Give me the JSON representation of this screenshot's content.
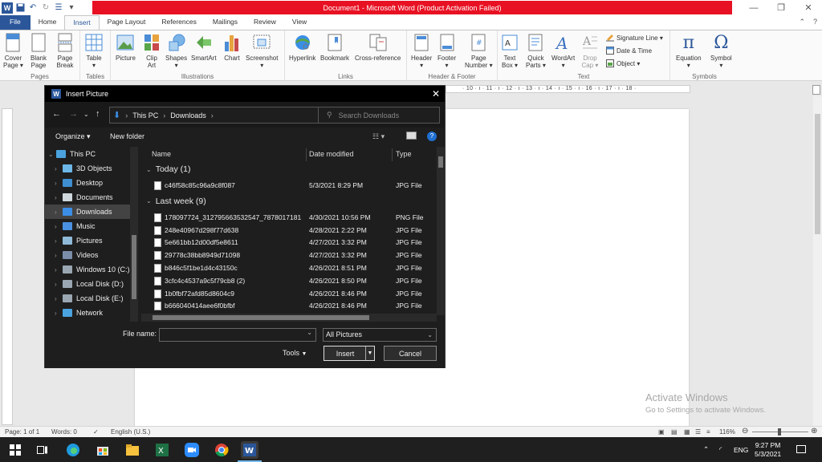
{
  "window": {
    "title": "Document1 - Microsoft Word (Product Activation Failed)"
  },
  "tabs": [
    {
      "label": "File"
    },
    {
      "label": "Home"
    },
    {
      "label": "Insert"
    },
    {
      "label": "Page Layout"
    },
    {
      "label": "References"
    },
    {
      "label": "Mailings"
    },
    {
      "label": "Review"
    },
    {
      "label": "View"
    }
  ],
  "ribbon": {
    "groups": {
      "pages": "Pages",
      "tables": "Tables",
      "illustrations": "Illustrations",
      "links": "Links",
      "header_footer": "Header & Footer",
      "text": "Text",
      "symbols": "Symbols"
    },
    "buttons": {
      "cover_page": [
        "Cover",
        "Page ▾"
      ],
      "blank_page": [
        "Blank",
        "Page"
      ],
      "page_break": [
        "Page",
        "Break"
      ],
      "table": [
        "Table",
        "▾"
      ],
      "picture": [
        "Picture",
        ""
      ],
      "clip_art": [
        "Clip",
        "Art"
      ],
      "shapes": [
        "Shapes",
        "▾"
      ],
      "smartart": [
        "SmartArt",
        ""
      ],
      "chart": [
        "Chart",
        ""
      ],
      "screenshot": [
        "Screenshot",
        "▾"
      ],
      "hyperlink": [
        "Hyperlink",
        ""
      ],
      "bookmark": [
        "Bookmark",
        ""
      ],
      "cross_reference": [
        "Cross-reference",
        ""
      ],
      "header": [
        "Header",
        "▾"
      ],
      "footer": [
        "Footer",
        "▾"
      ],
      "page_number": [
        "Page",
        "Number ▾"
      ],
      "text_box": [
        "Text",
        "Box ▾"
      ],
      "quick_parts": [
        "Quick",
        "Parts ▾"
      ],
      "wordart": [
        "WordArt",
        "▾"
      ],
      "drop_cap": [
        "Drop",
        "Cap ▾"
      ],
      "equation": [
        "Equation",
        "▾"
      ],
      "symbol": [
        "Symbol",
        "▾"
      ]
    },
    "small": {
      "signature_line": "Signature Line ▾",
      "date_time": "Date & Time",
      "object": "Object ▾"
    }
  },
  "ruler": {
    "marks": "· 10 · ı · 11 · ı · 12 · ı · 13 · ı · 14 · ı · 15 · ı · 16 · ı · 17 · ı · 18 ·"
  },
  "dialog": {
    "title": "Insert Picture",
    "breadcrumb": [
      "This PC",
      "Downloads"
    ],
    "search_placeholder": "Search Downloads",
    "organize": "Organize ▾",
    "new_folder": "New folder",
    "tree": [
      {
        "label": "This PC",
        "color": "#4aa3df"
      },
      {
        "label": "3D Objects",
        "color": "#6cb7e8"
      },
      {
        "label": "Desktop",
        "color": "#3e8ed0"
      },
      {
        "label": "Documents",
        "color": "#cfd8dc"
      },
      {
        "label": "Downloads",
        "color": "#3a8ee6"
      },
      {
        "label": "Music",
        "color": "#4a90e2"
      },
      {
        "label": "Pictures",
        "color": "#8fb9d8"
      },
      {
        "label": "Videos",
        "color": "#7a8ea8"
      },
      {
        "label": "Windows 10 (C:)",
        "color": "#9aa7b2"
      },
      {
        "label": "Local Disk (D:)",
        "color": "#9aa7b2"
      },
      {
        "label": "Local Disk (E:)",
        "color": "#9aa7b2"
      },
      {
        "label": "Network",
        "color": "#4aa3df"
      }
    ],
    "columns": {
      "name": "Name",
      "date": "Date modified",
      "type": "Type"
    },
    "groups": [
      {
        "label": "Today (1)",
        "files": [
          {
            "name": "c46f58c85c96a9c8f087",
            "date": "5/3/2021 8:29 PM",
            "type": "JPG File"
          }
        ]
      },
      {
        "label": "Last week (9)",
        "files": [
          {
            "name": "178097724_312795663532547_7878017181...",
            "date": "4/30/2021 10:56 PM",
            "type": "PNG File"
          },
          {
            "name": "248e40967d298f77d638",
            "date": "4/28/2021 2:22 PM",
            "type": "JPG File"
          },
          {
            "name": "5e661bb12d00df5e8611",
            "date": "4/27/2021 3:32 PM",
            "type": "JPG File"
          },
          {
            "name": "29778c38bb8949d71098",
            "date": "4/27/2021 3:32 PM",
            "type": "JPG File"
          },
          {
            "name": "b846c5f1be1d4c43150c",
            "date": "4/26/2021 8:51 PM",
            "type": "JPG File"
          },
          {
            "name": "3cfc4c4537a9c5f79cb8 (2)",
            "date": "4/26/2021 8:50 PM",
            "type": "JPG File"
          },
          {
            "name": "1b0fbf72afd85d8604c9",
            "date": "4/26/2021 8:46 PM",
            "type": "JPG File"
          },
          {
            "name": "b666040414aee6f0bfbf",
            "date": "4/26/2021 8:46 PM",
            "type": "JPG File"
          }
        ]
      }
    ],
    "file_name_label": "File name:",
    "file_name_value": "",
    "file_type": "All Pictures",
    "tools": "Tools",
    "insert": "Insert",
    "cancel": "Cancel"
  },
  "watermark": {
    "line1": "Activate Windows",
    "line2": "Go to Settings to activate Windows."
  },
  "status": {
    "page": "Page: 1 of 1",
    "words": "Words: 0",
    "language": "English (U.S.)",
    "zoom": "116%"
  },
  "tray": {
    "lang": "ENG",
    "time": "9:27 PM",
    "date": "5/3/2021"
  }
}
